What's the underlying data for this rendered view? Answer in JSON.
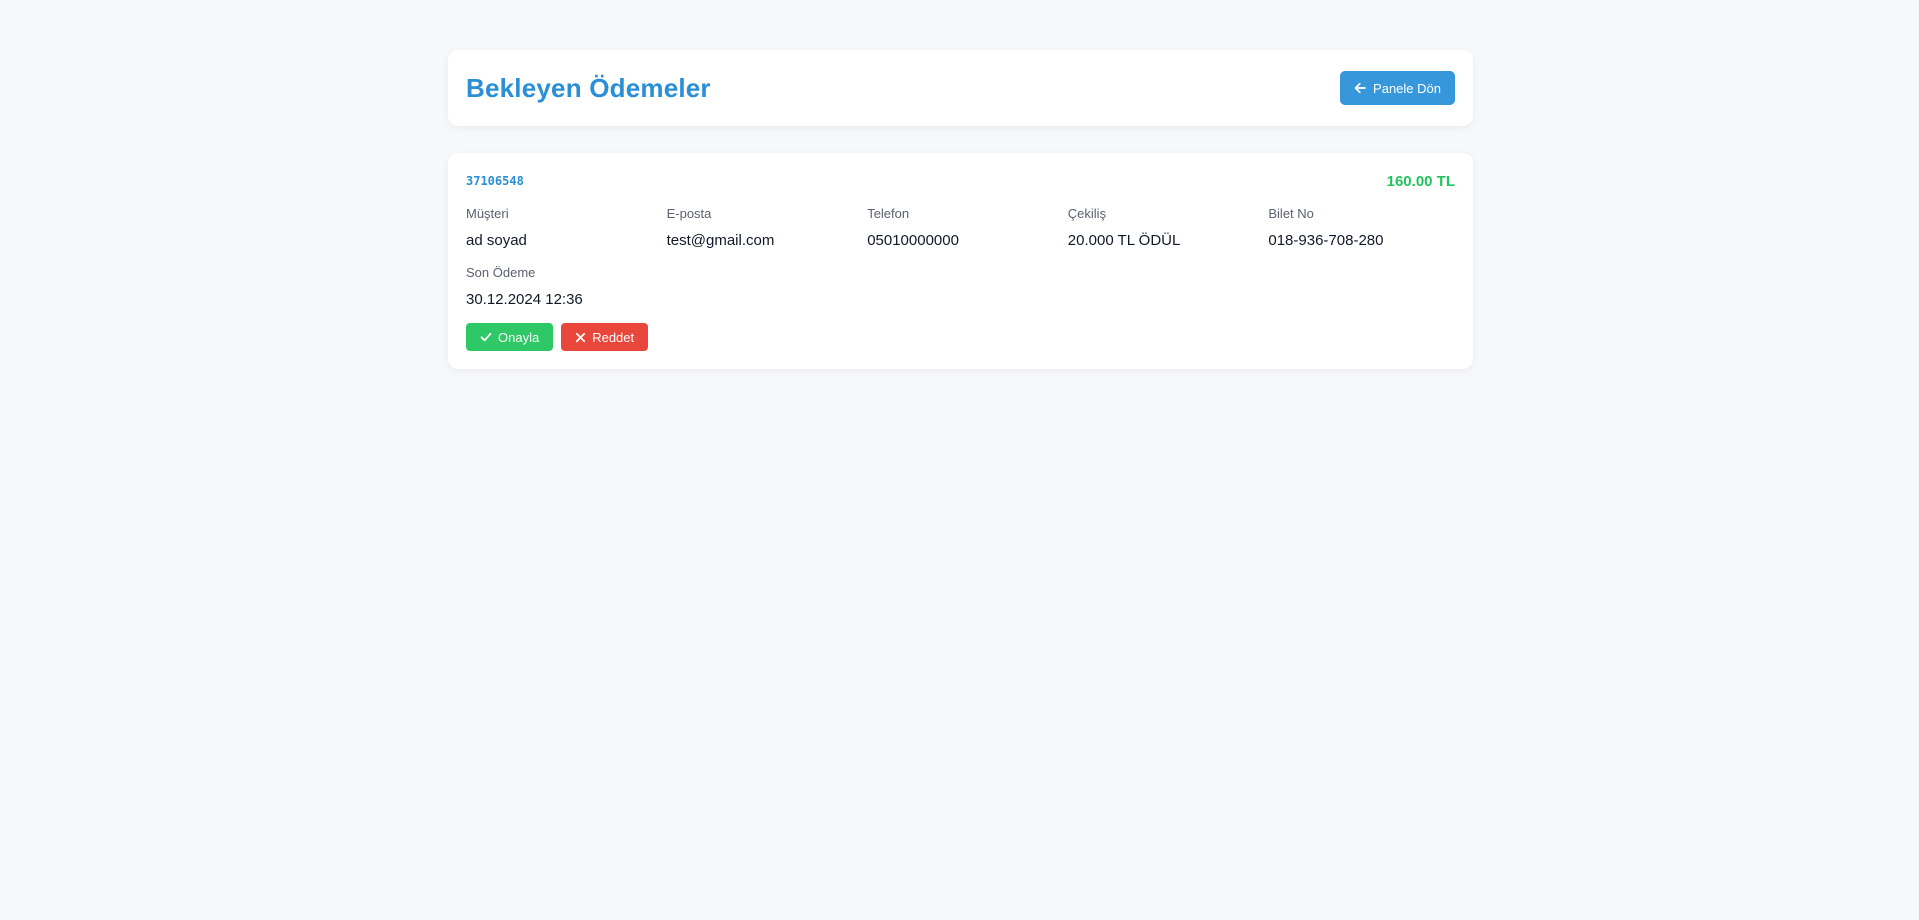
{
  "header": {
    "title": "Bekleyen Ödemeler",
    "back_button_label": "Panele Dön",
    "back_icon": "arrow-left-icon"
  },
  "payment": {
    "id": "37106548",
    "amount": "160.00 TL",
    "fields": [
      {
        "label": "Müşteri",
        "value": "ad soyad"
      },
      {
        "label": "E-posta",
        "value": "test@gmail.com"
      },
      {
        "label": "Telefon",
        "value": "05010000000"
      },
      {
        "label": "Çekiliş",
        "value": "20.000 TL ÖDÜL"
      },
      {
        "label": "Bilet No",
        "value": "018-936-708-280"
      },
      {
        "label": "Son Ödeme",
        "value": "30.12.2024 12:36"
      }
    ],
    "approve_label": "Onayla",
    "approve_icon": "check-icon",
    "reject_label": "Reddet",
    "reject_icon": "close-icon"
  },
  "colors": {
    "title": "#2a8fd6",
    "back_button": "#3797db",
    "amount": "#22c35e",
    "approve": "#2ec866",
    "reject": "#e9473b",
    "background": "#f7f8fa"
  }
}
